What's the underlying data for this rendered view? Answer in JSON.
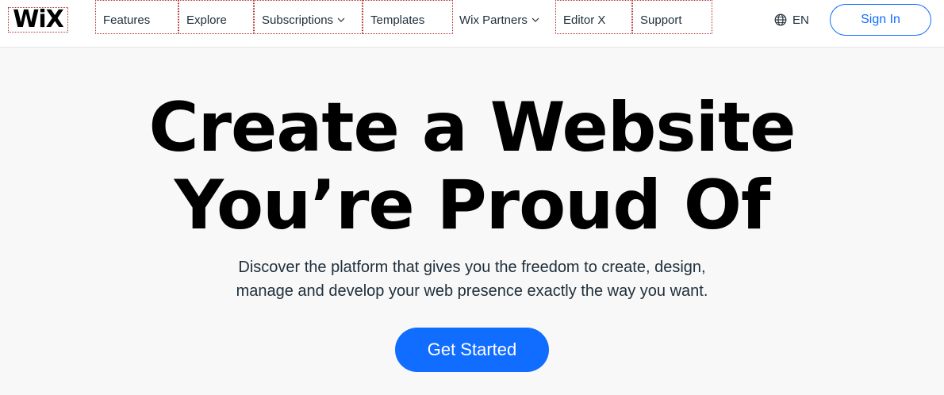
{
  "header": {
    "logo_text": "WiX",
    "nav": [
      {
        "label": "Features",
        "has_dropdown": false
      },
      {
        "label": "Explore",
        "has_dropdown": false
      },
      {
        "label": "Subscriptions",
        "has_dropdown": true
      },
      {
        "label": "Templates",
        "has_dropdown": false
      },
      {
        "label": "Wix Partners",
        "has_dropdown": true
      },
      {
        "label": "Editor X",
        "has_dropdown": false
      },
      {
        "label": "Support",
        "has_dropdown": false
      }
    ],
    "language": "EN",
    "language_icon": "globe-icon",
    "signin_label": "Sign In"
  },
  "hero": {
    "title_line1": "Create a Website",
    "title_line2": "You’re Proud Of",
    "subtitle_line1": "Discover the platform that gives you the freedom to create, design,",
    "subtitle_line2": "manage and develop your web presence exactly the way you want.",
    "cta_label": "Get Started"
  },
  "colors": {
    "accent": "#116dff",
    "text": "#20303c",
    "background": "#f8f8f8"
  }
}
